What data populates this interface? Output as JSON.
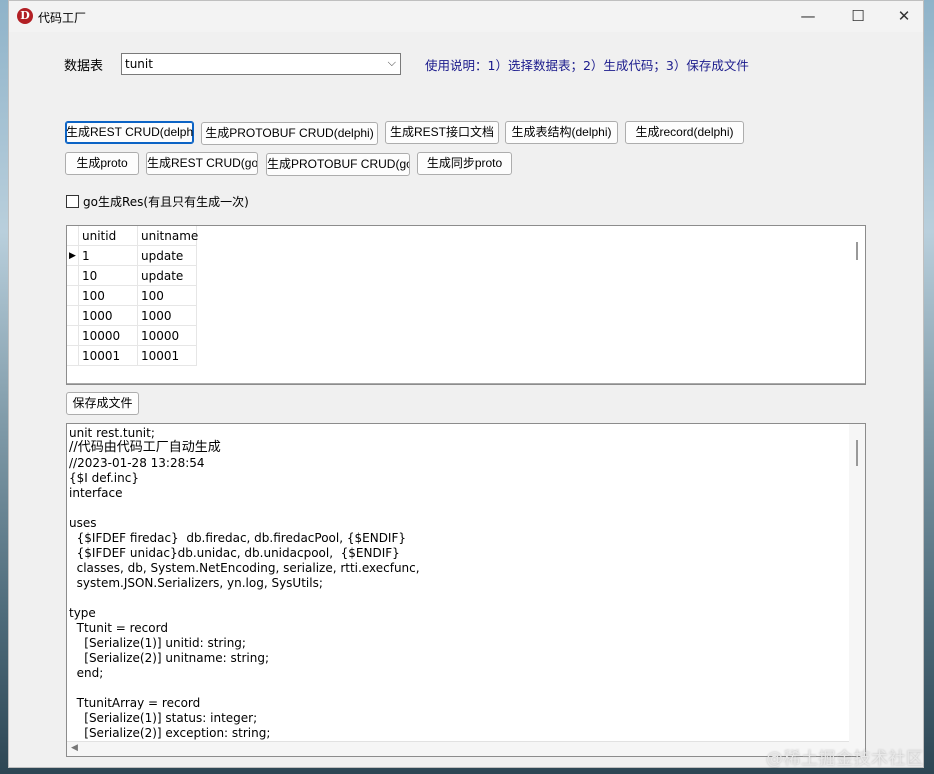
{
  "window": {
    "title": "代码工厂",
    "app_icon_letter": "D",
    "controls": {
      "minimize": "—",
      "maximize": "☐",
      "close": "✕"
    }
  },
  "table_select": {
    "label": "数据表",
    "value": "tunit",
    "help": "使用说明：1）选择数据表；2）生成代码；3）保存成文件"
  },
  "buttons_row1": [
    "生成REST CRUD(delphi)",
    "生成PROTOBUF CRUD(delphi)",
    "生成REST接口文档",
    "生成表结构(delphi)",
    "生成record(delphi)"
  ],
  "buttons_row2": [
    "生成proto",
    "生成REST CRUD(go)",
    "生成PROTOBUF CRUD(go)",
    "生成同步proto"
  ],
  "checkbox": {
    "label": "go生成Res(有且只有生成一次)",
    "checked": false
  },
  "grid": {
    "columns": [
      "unitid",
      "unitname"
    ],
    "rows": [
      [
        "1",
        "update"
      ],
      [
        "10",
        "update"
      ],
      [
        "100",
        "100"
      ],
      [
        "1000",
        "1000"
      ],
      [
        "10000",
        "10000"
      ],
      [
        "10001",
        "10001"
      ]
    ],
    "current_row_indicator": "▶"
  },
  "save_button": "保存成文件",
  "code_lines": [
    "unit rest.tunit;",
    "//代码由代码工厂自动生成",
    "//2023-01-28 13:28:54",
    "{$I def.inc}",
    "interface",
    "",
    "uses",
    "  {$IFDEF firedac}  db.firedac, db.firedacPool, {$ENDIF}",
    "  {$IFDEF unidac}db.unidac, db.unidacpool,  {$ENDIF}",
    "  classes, db, System.NetEncoding, serialize, rtti.execfunc,",
    "  system.JSON.Serializers, yn.log, SysUtils;",
    "",
    "type",
    "  Ttunit = record",
    "    [Serialize(1)] unitid: string;",
    "    [Serialize(2)] unitname: string;",
    "  end;",
    "",
    "  TtunitArray = record",
    "    [Serialize(1)] status: integer;",
    "    [Serialize(2)] exception: string;"
  ],
  "watermark": "@稀土掘金技术社区"
}
